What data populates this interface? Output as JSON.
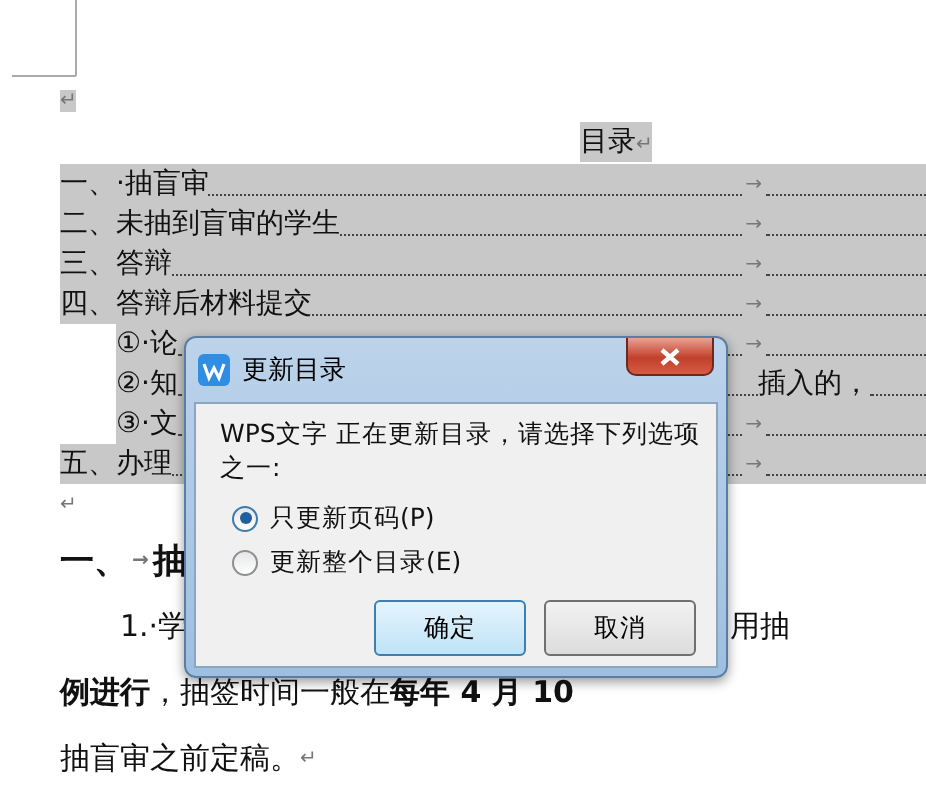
{
  "paragraph_mark": "↵",
  "toc_title": "目录",
  "toc_entries": [
    {
      "kind": "main",
      "text": "一、·抽盲审",
      "tab_mark": "→"
    },
    {
      "kind": "main",
      "text": "二、未抽到盲审的学生",
      "tab_mark": "→"
    },
    {
      "kind": "main",
      "text": "三、答辩",
      "tab_mark": "→"
    },
    {
      "kind": "main",
      "text": "四、答辩后材料提交",
      "tab_mark": "→"
    },
    {
      "kind": "sub",
      "text": "①·论",
      "tab_mark": "→"
    },
    {
      "kind": "sub",
      "text": "②·知",
      "right_text": "插入的，"
    },
    {
      "kind": "sub",
      "text": "③·文",
      "tab_mark": "→"
    },
    {
      "kind": "main",
      "text": "五、办理",
      "tab_mark": "→"
    }
  ],
  "body": [
    {
      "kind": "heading",
      "text": "一、",
      "tab_mark": "→",
      "after": "抽"
    },
    {
      "kind": "indent",
      "text": "1.·学",
      "right_text": "用抽"
    },
    {
      "kind": "para",
      "text": "**例进行**，抽签时间一般在**每年 4 月 10**"
    },
    {
      "kind": "para",
      "text": "抽盲审之前定稿。",
      "mark": "↵"
    }
  ],
  "dialog": {
    "title": "更新目录",
    "message": "WPS文字 正在更新目录，请选择下列选项之一:",
    "options": [
      {
        "label": "只更新页码(P)",
        "selected": true
      },
      {
        "label": "更新整个目录(E)",
        "selected": false
      }
    ],
    "buttons": [
      {
        "label": "确定",
        "kind": "default"
      },
      {
        "label": "取消",
        "kind": "normal"
      }
    ]
  }
}
